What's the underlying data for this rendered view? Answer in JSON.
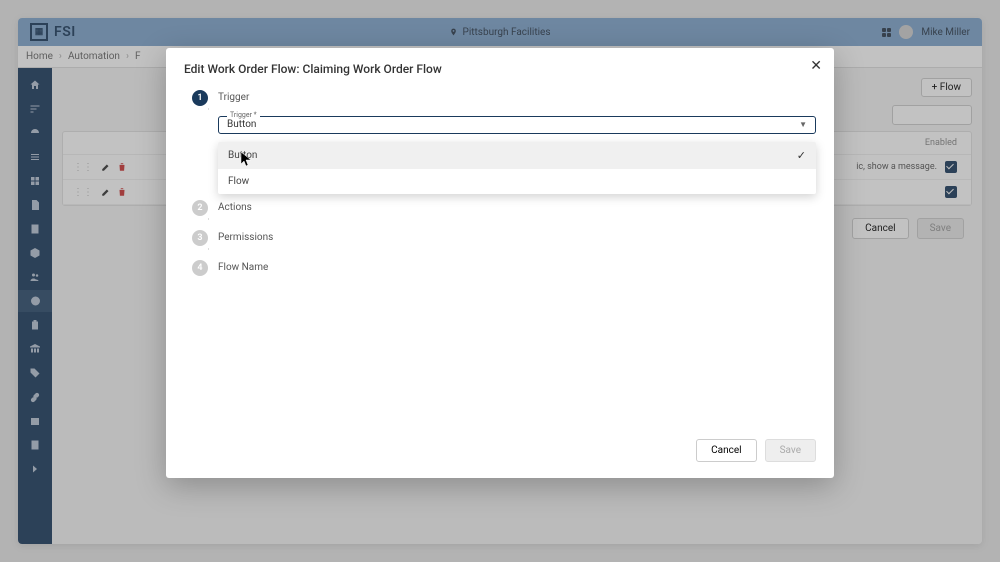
{
  "brand": "FSI",
  "topbar": {
    "location": "Pittsburgh Facilities",
    "user_name": "Mike Miller"
  },
  "breadcrumb": {
    "items": [
      "Home",
      "Automation",
      "F"
    ]
  },
  "content": {
    "flow_button": "+  Flow",
    "enabled_header": "Enabled",
    "row1_text": "ic, show a message.",
    "cancel": "Cancel",
    "save": "Save"
  },
  "modal": {
    "title": "Edit Work Order Flow: Claiming Work Order Flow",
    "steps": {
      "s1": {
        "num": "1",
        "label": "Trigger"
      },
      "s2": {
        "num": "2",
        "label": "Actions"
      },
      "s3": {
        "num": "3",
        "label": "Permissions"
      },
      "s4": {
        "num": "4",
        "label": "Flow Name"
      }
    },
    "trigger_field": {
      "label": "Trigger *",
      "value": "Button"
    },
    "dropdown": {
      "opt1": "Button",
      "opt2": "Flow"
    },
    "footer": {
      "cancel": "Cancel",
      "save": "Save"
    }
  }
}
